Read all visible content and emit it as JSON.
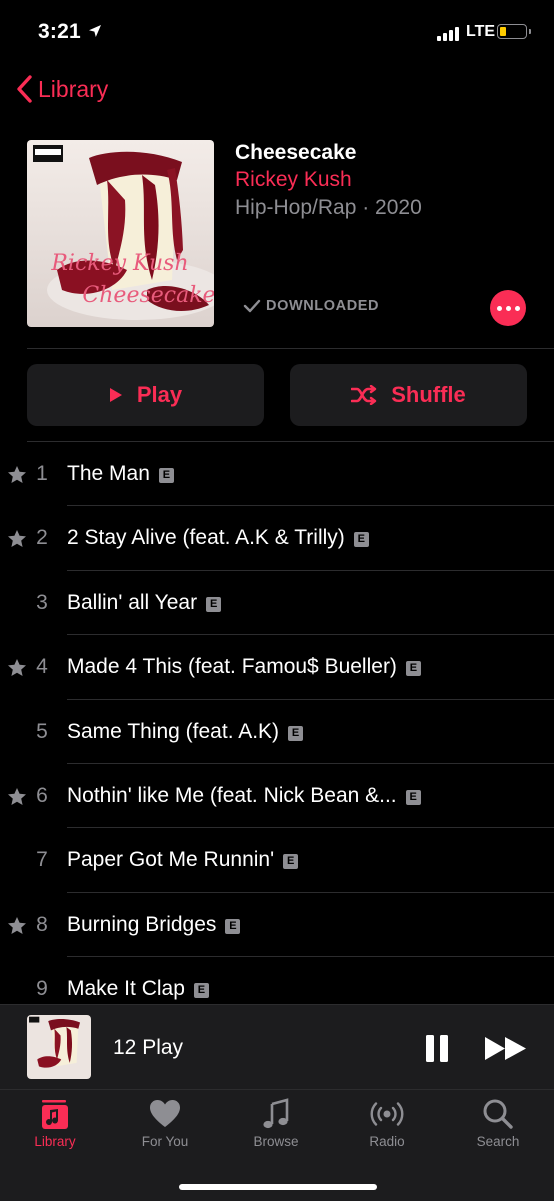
{
  "status": {
    "time": "3:21",
    "network": "LTE",
    "battery_level_fraction": 0.2
  },
  "nav": {
    "back_label": "Library"
  },
  "album": {
    "title": "Cheesecake",
    "artist": "Rickey Kush",
    "meta": "Hip-Hop/Rap · 2020",
    "downloaded_label": "DOWNLOADED",
    "cover_text_artist": "Rickey Kush",
    "cover_text_title": "Cheesecake",
    "cover_badge": "PARENTAL ADVISORY EXPLICIT CONTENT"
  },
  "actions": {
    "play_label": "Play",
    "shuffle_label": "Shuffle"
  },
  "tracks": [
    {
      "number": "1",
      "title": "The Man",
      "starred": true,
      "explicit": true
    },
    {
      "number": "2",
      "title": "2 Stay Alive (feat. A.K & Trilly)",
      "starred": true,
      "explicit": true
    },
    {
      "number": "3",
      "title": "Ballin' all Year",
      "starred": false,
      "explicit": true
    },
    {
      "number": "4",
      "title": "Made 4 This (feat. Famou$ Bueller)",
      "starred": true,
      "explicit": true
    },
    {
      "number": "5",
      "title": "Same Thing (feat. A.K)",
      "starred": false,
      "explicit": true
    },
    {
      "number": "6",
      "title": "Nothin' like Me (feat. Nick Bean &...",
      "starred": true,
      "explicit": true
    },
    {
      "number": "7",
      "title": "Paper Got Me Runnin'",
      "starred": false,
      "explicit": true
    },
    {
      "number": "8",
      "title": "Burning Bridges",
      "starred": true,
      "explicit": true
    },
    {
      "number": "9",
      "title": "Make It Clap",
      "starred": false,
      "explicit": true
    }
  ],
  "explicit_badge": "E",
  "now_playing": {
    "title": "12 Play"
  },
  "tabs": [
    {
      "label": "Library",
      "icon": "library-icon",
      "active": true
    },
    {
      "label": "For You",
      "icon": "heart-icon",
      "active": false
    },
    {
      "label": "Browse",
      "icon": "music-note-icon",
      "active": false
    },
    {
      "label": "Radio",
      "icon": "radio-icon",
      "active": false
    },
    {
      "label": "Search",
      "icon": "search-icon",
      "active": false
    }
  ],
  "colors": {
    "accent": "#fa2d55",
    "secondary_text": "#8e8e93",
    "surface": "#1c1c1e",
    "background": "#000000"
  }
}
